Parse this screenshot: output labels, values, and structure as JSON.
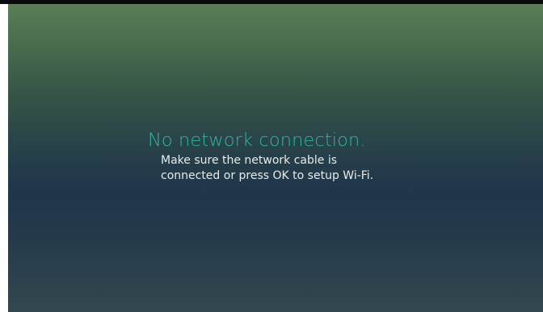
{
  "dialog": {
    "title": "No network connection.",
    "line1": "Make sure the network cable is",
    "line2": "connected or press OK to setup Wi-Fi."
  },
  "colors": {
    "title": "#2fb6a0",
    "body_text": "#e6ece9",
    "background_top": "#5a7e55",
    "background_middle": "#1f354a",
    "background_bottom": "#33474f"
  }
}
